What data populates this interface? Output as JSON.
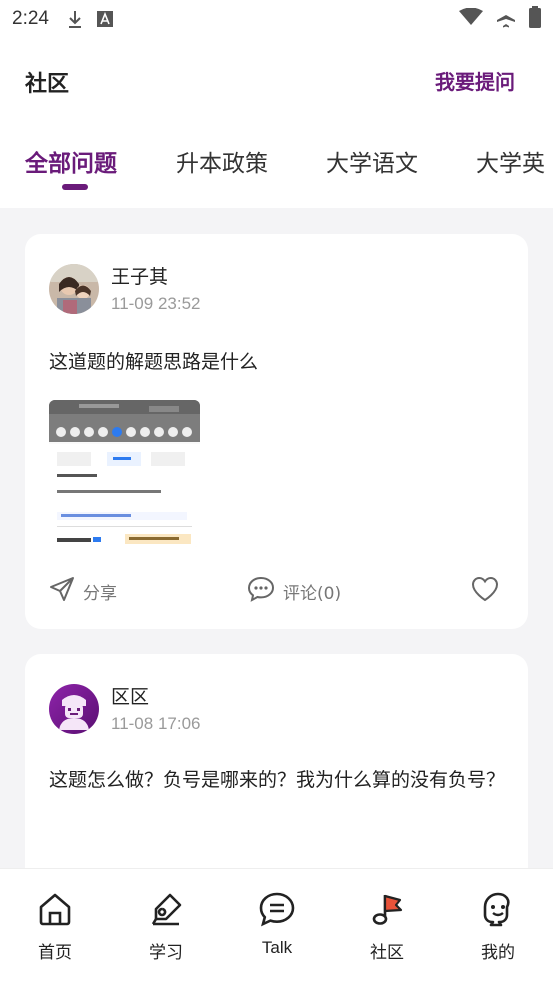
{
  "status_bar": {
    "time": "2:24"
  },
  "header": {
    "title": "社区",
    "ask_button": "我要提问"
  },
  "tabs": [
    {
      "label": "全部问题",
      "active": true
    },
    {
      "label": "升本政策",
      "active": false
    },
    {
      "label": "大学语文",
      "active": false
    },
    {
      "label": "大学英",
      "active": false
    }
  ],
  "posts": [
    {
      "author": "王子其",
      "time": "11-09 23:52",
      "content": "这道题的解题思路是什么",
      "share_label": "分享",
      "comment_label": "评论(0)"
    },
    {
      "author": "区区",
      "time": "11-08 17:06",
      "content": "这题怎么做？负号是哪来的？我为什么算的没有负号？"
    }
  ],
  "bottom_nav": [
    {
      "label": "首页",
      "icon": "home-icon"
    },
    {
      "label": "学习",
      "icon": "pen-icon"
    },
    {
      "label": "Talk",
      "icon": "chat-icon"
    },
    {
      "label": "社区",
      "icon": "community-flag-icon",
      "active": true
    },
    {
      "label": "我的",
      "icon": "profile-icon"
    }
  ],
  "colors": {
    "accent": "#6a1b7a",
    "background": "#f4f4f6"
  }
}
